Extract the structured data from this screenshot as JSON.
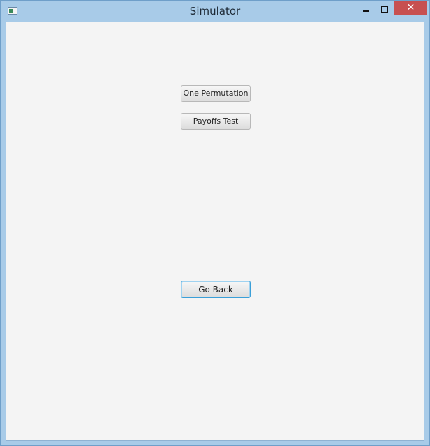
{
  "window": {
    "title": "Simulator",
    "close_glyph": "✕"
  },
  "buttons": {
    "one_permutation": "One Permutation",
    "payoffs_test": "Payoffs Test",
    "go_back": "Go Back"
  }
}
